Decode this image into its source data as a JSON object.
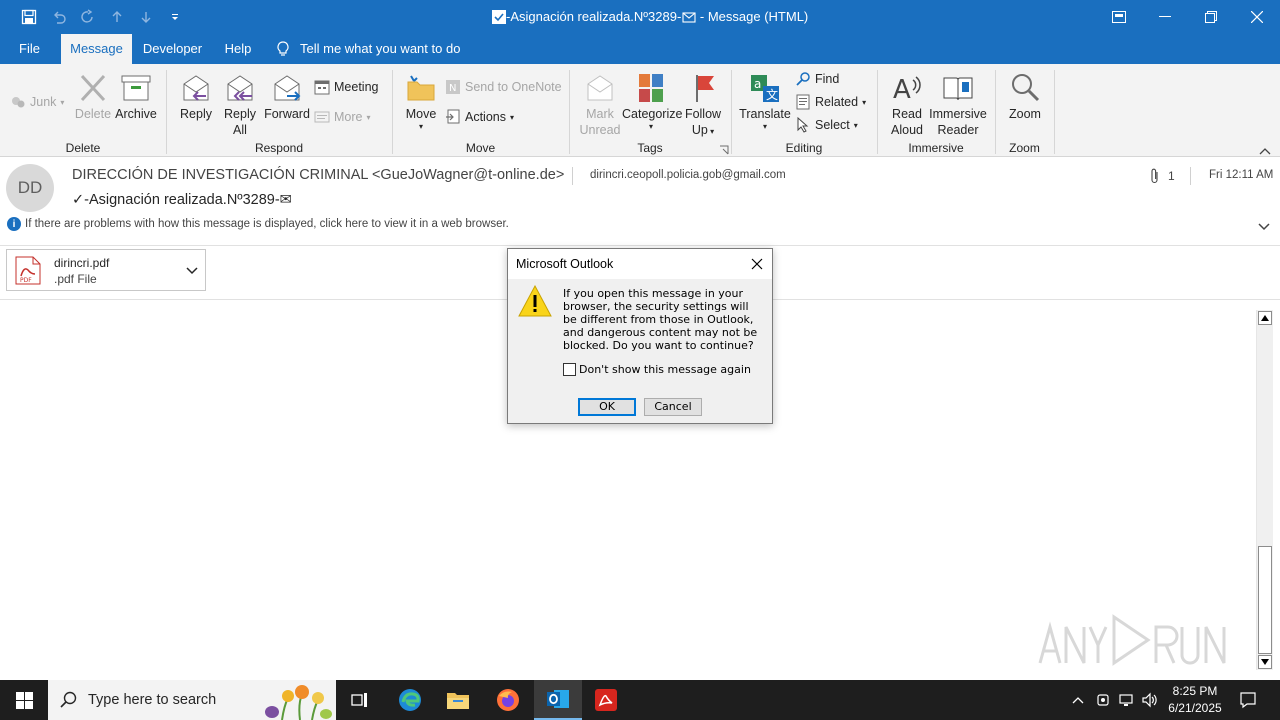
{
  "window": {
    "title": "-Asignación realizada.Nº3289-",
    "title_suffix": " - Message (HTML)"
  },
  "menu_tabs": [
    {
      "label": "File"
    },
    {
      "label": "Message",
      "active": true
    },
    {
      "label": "Developer"
    },
    {
      "label": "Help"
    }
  ],
  "tell_me": "Tell me what you want to do",
  "ribbon": {
    "delete_group": {
      "label": "Delete",
      "junk": "Junk",
      "delete": "Delete",
      "archive": "Archive"
    },
    "respond_group": {
      "label": "Respond",
      "reply": "Reply",
      "reply_all_line1": "Reply",
      "reply_all_line2": "All",
      "forward": "Forward",
      "meeting": "Meeting",
      "more": "More"
    },
    "move_group": {
      "label": "Move",
      "move": "Move",
      "send_to_onenote": "Send to OneNote",
      "actions": "Actions"
    },
    "tags_group": {
      "label": "Tags",
      "mark_unread_line1": "Mark",
      "mark_unread_line2": "Unread",
      "categorize": "Categorize",
      "follow_up_line1": "Follow",
      "follow_up_line2": "Up"
    },
    "editing_group": {
      "label": "Editing",
      "translate": "Translate",
      "find": "Find",
      "related": "Related",
      "select": "Select"
    },
    "immersive_group": {
      "label": "Immersive",
      "read_aloud_line1": "Read",
      "read_aloud_line2": "Aloud",
      "immersive_reader_line1": "Immersive",
      "immersive_reader_line2": "Reader"
    },
    "zoom_group": {
      "label": "Zoom",
      "zoom": "Zoom"
    }
  },
  "message": {
    "avatar_initials": "DD",
    "sender": "DIRECCIÓN DE INVESTIGACIÓN CRIMINAL <GueJoWagner@t-online.de>",
    "recipient": "dirincri.ceopoll.policia.gob@gmail.com",
    "attachment_count": "1",
    "time": "Fri 12:11 AM",
    "subject": "✓-Asignación realizada.Nº3289-✉",
    "info_bar": "If there are problems with how this message is displayed, click here to view it in a web browser.",
    "attachment": {
      "name": "dirincri.pdf",
      "type": ".pdf File"
    }
  },
  "dialog": {
    "title": "Microsoft Outlook",
    "text": "If you open this message in your browser, the security settings will be different from those in Outlook, and dangerous content may not be blocked. Do you want to continue?",
    "checkbox_label": "Don't show this message again",
    "ok": "OK",
    "cancel": "Cancel"
  },
  "taskbar": {
    "search_placeholder": "Type here to search",
    "time": "8:25 PM",
    "date": "6/21/2025"
  },
  "colors": {
    "titlebar": "#1a6fbf",
    "ribbon_bg": "#f3f3f3",
    "taskbar": "#1e1e1e",
    "dialog_accent": "#0078d7"
  }
}
